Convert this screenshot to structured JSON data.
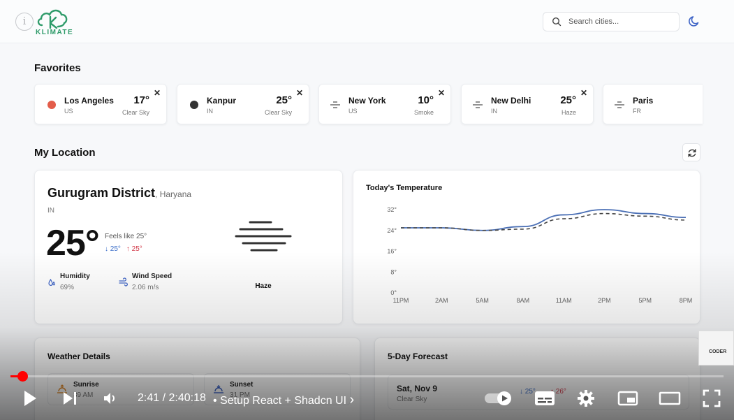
{
  "header": {
    "brand": "KLIMATE",
    "search_placeholder": "Search cities..."
  },
  "favorites": {
    "title": "Favorites",
    "items": [
      {
        "city": "Los Angeles",
        "country": "US",
        "temp": "17°",
        "condition": "Clear Sky",
        "icon": "sun-dot",
        "color": "#e35d4a"
      },
      {
        "city": "Kanpur",
        "country": "IN",
        "temp": "25°",
        "condition": "Clear Sky",
        "icon": "moon-dot",
        "color": "#333333"
      },
      {
        "city": "New York",
        "country": "US",
        "temp": "10°",
        "condition": "Smoke",
        "icon": "haze-icon"
      },
      {
        "city": "New Delhi",
        "country": "IN",
        "temp": "25°",
        "condition": "Haze",
        "icon": "haze-icon"
      },
      {
        "city": "Paris",
        "country": "FR",
        "temp": "",
        "condition": "",
        "icon": "haze-icon"
      }
    ],
    "close_label": "✕"
  },
  "location": {
    "section_title": "My Location",
    "name": "Gurugram District",
    "region": ", Haryana",
    "country": "IN",
    "temp": "25°",
    "feels_like": "Feels like 25°",
    "min": "↓ 25°",
    "max": "↑ 25°",
    "humidity_label": "Humidity",
    "humidity_value": "69%",
    "wind_label": "Wind Speed",
    "wind_value": "2.06 m/s",
    "condition": "Haze"
  },
  "chart_data": {
    "type": "line",
    "title": "Today's Temperature",
    "categories": [
      "11PM",
      "2AM",
      "5AM",
      "8AM",
      "11AM",
      "2PM",
      "5PM",
      "8PM"
    ],
    "y_ticks": [
      "0°",
      "8°",
      "16°",
      "24°",
      "32°"
    ],
    "ylim": [
      0,
      32
    ],
    "series": [
      {
        "style": "solid",
        "color": "#4a6fb5",
        "values": [
          25,
          25,
          24,
          25.5,
          30,
          32,
          30.5,
          29
        ]
      },
      {
        "style": "dashed",
        "color": "#444444",
        "values": [
          25,
          25,
          24,
          24.5,
          28.5,
          30.5,
          29.5,
          28
        ]
      }
    ],
    "grid": false
  },
  "details": {
    "title": "Weather Details",
    "sunrise_label": "Sunrise",
    "sunrise_value": "39 AM",
    "sunset_label": "Sunset",
    "sunset_value": "31 PM"
  },
  "forecast": {
    "title": "5-Day Forecast",
    "day": "Sat, Nov 9",
    "condition": "Clear Sky",
    "min": "↓ 25°",
    "max": "↑ 26°"
  },
  "player": {
    "time": "2:41 / 2:40:18",
    "chapter": "• Setup React + Shadcn UI",
    "chapter_arrow": "›",
    "progress": 0.017,
    "watermark": "CODER"
  }
}
